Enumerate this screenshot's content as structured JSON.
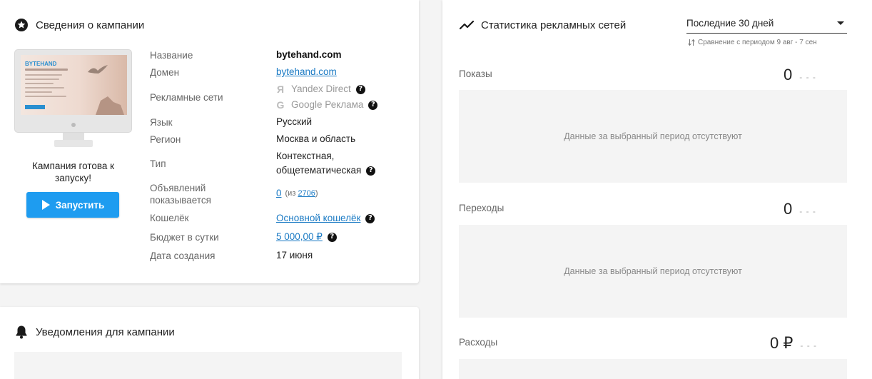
{
  "campaign": {
    "title": "Сведения о кампании",
    "preview": {
      "brand": "BYTEHAND"
    },
    "ready_text": "Кампания готова к запуску!",
    "launch_label": "Запустить",
    "fields": {
      "name_label": "Название",
      "name_value": "bytehand.com",
      "domain_label": "Домен",
      "domain_value": "bytehand.com",
      "networks_label": "Рекламные сети",
      "networks": [
        {
          "name": "Yandex Direct",
          "icon": "yandex-icon"
        },
        {
          "name": "Google Реклама",
          "icon": "google-icon"
        }
      ],
      "language_label": "Язык",
      "language_value": "Русский",
      "region_label": "Регион",
      "region_value": "Москва и область",
      "type_label": "Тип",
      "type_value_1": "Контекстная,",
      "type_value_2": "общетематическая",
      "ads_label_1": "Объявлений",
      "ads_label_2": "показывается",
      "ads_shown": "0",
      "ads_of_prefix": "(из",
      "ads_total": "2706",
      "ads_of_suffix": ")",
      "wallet_label": "Кошелёк",
      "wallet_value": "Основной кошелёк",
      "budget_label": "Бюджет в сутки",
      "budget_value": "5 000,00 ₽",
      "created_label": "Дата создания",
      "created_value": "17 июня"
    }
  },
  "notifications": {
    "title": "Уведомления для кампании"
  },
  "stats": {
    "title": "Статистика рекламных сетей",
    "period": "Последние 30 дней",
    "compare_text": "Сравнение с периодом 9 авг - 7 сен",
    "empty_text": "Данные за выбранный период отсутствуют",
    "metrics": [
      {
        "label": "Показы",
        "value": "0",
        "trend": "- - -"
      },
      {
        "label": "Переходы",
        "value": "0",
        "trend": "- - -"
      },
      {
        "label": "Расходы",
        "value": "0 ₽",
        "trend": "- - -"
      }
    ]
  },
  "colors": {
    "accent": "#1e9cf0",
    "link": "#1a7ac4",
    "background": "#f4f4f4"
  }
}
